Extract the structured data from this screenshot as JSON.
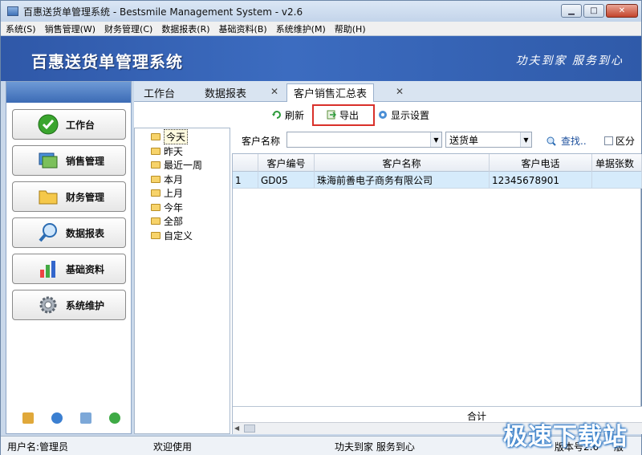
{
  "window": {
    "title": "百惠送货单管理系统 - Bestsmile Management System - v2.6"
  },
  "menu": [
    "系统(S)",
    "销售管理(W)",
    "财务管理(C)",
    "数据报表(R)",
    "基础资料(B)",
    "系统维护(M)",
    "帮助(H)"
  ],
  "banner": {
    "title": "百惠送货单管理系统",
    "slogan": "功夫到家 服务到心"
  },
  "nav": [
    {
      "label": "工作台",
      "icon": "checkmark-icon"
    },
    {
      "label": "销售管理",
      "icon": "monitor-icon"
    },
    {
      "label": "财务管理",
      "icon": "folder-icon"
    },
    {
      "label": "数据报表",
      "icon": "magnifier-icon"
    },
    {
      "label": "基础资料",
      "icon": "chart-icon"
    },
    {
      "label": "系统维护",
      "icon": "gear-icon"
    }
  ],
  "tabs": {
    "workbench": "工作台",
    "reports": "数据报表",
    "sales_summary": "客户销售汇总表"
  },
  "toolbar": {
    "refresh": "刷新",
    "export": "导出",
    "display_settings": "显示设置"
  },
  "tree": [
    "今天",
    "昨天",
    "最近一周",
    "本月",
    "上月",
    "今年",
    "全部",
    "自定义"
  ],
  "filter": {
    "customer_label": "客户名称",
    "customer_value": "",
    "doc_type": "送货单",
    "search": "查找..",
    "split_checkbox": "区分"
  },
  "grid": {
    "columns": [
      "",
      "客户编号",
      "客户名称",
      "客户电话",
      "单据张数"
    ],
    "rows": [
      [
        "1",
        "GD05",
        "珠海前善电子商务有限公司",
        "12345678901",
        ""
      ]
    ],
    "footer_label": "合计"
  },
  "status": {
    "user": "用户名:管理员",
    "welcome": "欢迎使用",
    "slogan": "功夫到家 服务到心",
    "version": "版本号2.6",
    "extra": "版"
  },
  "watermark": "极速下载站"
}
